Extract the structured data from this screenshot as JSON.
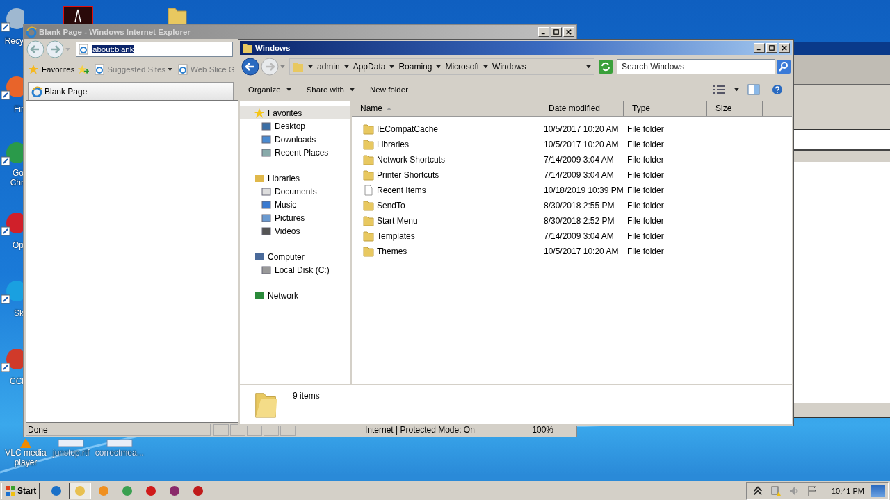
{
  "desktop": {
    "column_icons": [
      {
        "label": "Recy",
        "kind": "bin"
      },
      {
        "label": "Fir",
        "kind": "firefox"
      },
      {
        "label": "Go Chr",
        "kind": "chrome"
      },
      {
        "label": "Op",
        "kind": "opera"
      },
      {
        "label": "Sk",
        "kind": "skype"
      },
      {
        "label": "CCl",
        "kind": "ccleaner"
      }
    ],
    "bottom_icons": [
      {
        "label": "VLC media player",
        "kind": "vlc"
      },
      {
        "label": "junstop.rtf",
        "kind": "document"
      },
      {
        "label": "correctmea...",
        "kind": "document"
      }
    ]
  },
  "ie_window": {
    "title": "Blank Page - Windows Internet Explorer",
    "address": "about:blank",
    "favorites": "Favorites",
    "links": [
      "Suggested Sites",
      "Web Slice G"
    ],
    "tab": "Blank Page",
    "status": "Done",
    "zone": "Internet | Protected Mode: On",
    "zoom": "100%"
  },
  "explorer": {
    "title": "Windows",
    "breadcrumb": [
      "admin",
      "AppData",
      "Roaming",
      "Microsoft",
      "Windows"
    ],
    "search": {
      "placeholder": "Search Windows"
    },
    "toolbar": [
      {
        "label": "Organize",
        "dropdown": true
      },
      {
        "label": "Share with",
        "dropdown": true
      },
      {
        "label": "New folder",
        "dropdown": false
      }
    ],
    "nav": [
      {
        "label": "Favorites",
        "kind": "star",
        "children": [
          {
            "label": "Desktop",
            "kind": "desktop"
          },
          {
            "label": "Downloads",
            "kind": "downloads"
          },
          {
            "label": "Recent Places",
            "kind": "recent"
          }
        ]
      },
      {
        "label": "Libraries",
        "kind": "library",
        "children": [
          {
            "label": "Documents",
            "kind": "documents"
          },
          {
            "label": "Music",
            "kind": "music"
          },
          {
            "label": "Pictures",
            "kind": "pictures"
          },
          {
            "label": "Videos",
            "kind": "videos"
          }
        ]
      },
      {
        "label": "Computer",
        "kind": "computer",
        "children": [
          {
            "label": "Local Disk (C:)",
            "kind": "disk"
          }
        ]
      },
      {
        "label": "Network",
        "kind": "network"
      }
    ],
    "columns": [
      {
        "label": "Name",
        "sorted": true
      },
      {
        "label": "Date modified",
        "sorted": false
      },
      {
        "label": "Type",
        "sorted": false
      },
      {
        "label": "Size",
        "sorted": false
      }
    ],
    "rows": [
      {
        "name": "IECompatCache",
        "kind": "folder",
        "date": "10/5/2017 10:20 AM",
        "type": "File folder"
      },
      {
        "name": "Libraries",
        "kind": "folder",
        "date": "10/5/2017 10:20 AM",
        "type": "File folder"
      },
      {
        "name": "Network Shortcuts",
        "kind": "folder",
        "date": "7/14/2009 3:04 AM",
        "type": "File folder"
      },
      {
        "name": "Printer Shortcuts",
        "kind": "folder",
        "date": "7/14/2009 3:04 AM",
        "type": "File folder"
      },
      {
        "name": "Recent Items",
        "kind": "file",
        "date": "10/18/2019 10:39 PM",
        "type": "File folder"
      },
      {
        "name": "SendTo",
        "kind": "folder",
        "date": "8/30/2018 2:55 PM",
        "type": "File folder"
      },
      {
        "name": "Start Menu",
        "kind": "folder",
        "date": "8/30/2018 2:52 PM",
        "type": "File folder"
      },
      {
        "name": "Templates",
        "kind": "folder",
        "date": "7/14/2009 3:04 AM",
        "type": "File folder"
      },
      {
        "name": "Themes",
        "kind": "folder",
        "date": "10/5/2017 10:20 AM",
        "type": "File folder"
      }
    ],
    "status": "9 items"
  },
  "taskbar": {
    "start": "Start",
    "apps": [
      {
        "kind": "ie",
        "active": false
      },
      {
        "kind": "explorer",
        "active": true
      },
      {
        "kind": "media",
        "active": false
      },
      {
        "kind": "chrome",
        "active": false
      },
      {
        "kind": "opera",
        "active": false
      },
      {
        "kind": "winrar",
        "active": false
      },
      {
        "kind": "red",
        "active": false
      }
    ],
    "time": "10:41 PM"
  }
}
